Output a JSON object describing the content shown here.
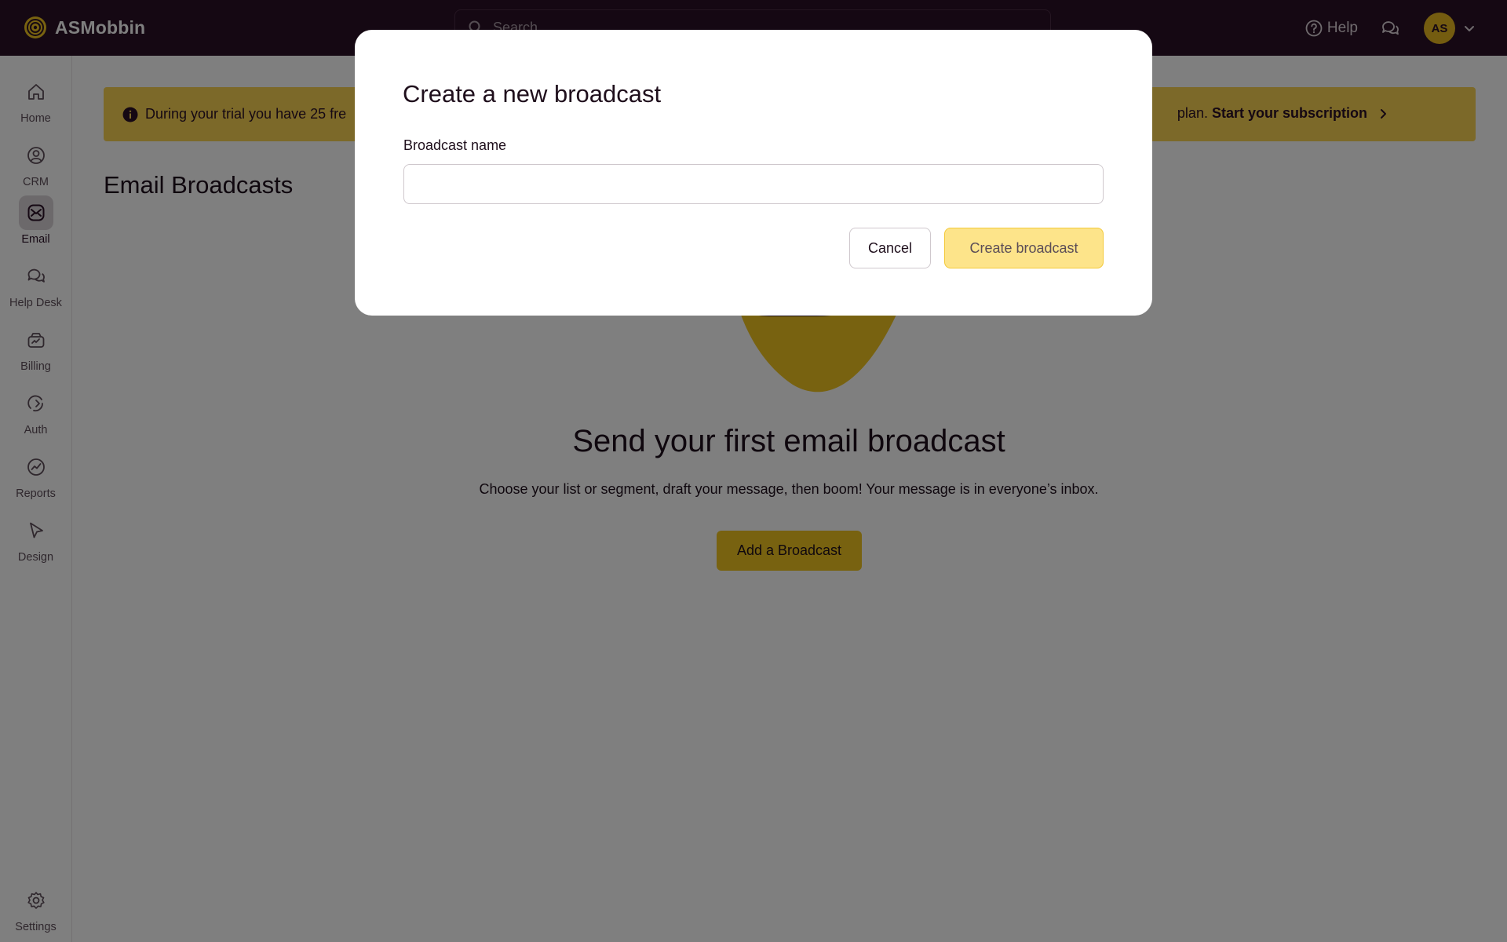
{
  "topbar": {
    "brand_name": "ASMobbin",
    "search_placeholder": "Search",
    "help_label": "Help",
    "avatar_initials": "AS"
  },
  "sidebar": {
    "items": [
      {
        "label": "Home",
        "icon": "home-icon"
      },
      {
        "label": "CRM",
        "icon": "contact-icon"
      },
      {
        "label": "Email",
        "icon": "email-icon",
        "active": true
      },
      {
        "label": "Help Desk",
        "icon": "chat-icon"
      },
      {
        "label": "Billing",
        "icon": "billing-icon"
      },
      {
        "label": "Auth",
        "icon": "auth-icon"
      },
      {
        "label": "Reports",
        "icon": "chart-icon"
      },
      {
        "label": "Design",
        "icon": "cursor-icon"
      },
      {
        "label": "Settings",
        "icon": "gear-icon"
      }
    ]
  },
  "banner": {
    "text": "During your trial you have 25 fre",
    "cta_prefix": "plan. ",
    "cta_link": "Start your subscription"
  },
  "main": {
    "title": "Email Broadcasts",
    "empty_title": "Send your first email broadcast",
    "empty_desc": "Choose your list or segment, draft your message, then boom! Your message is in everyone’s inbox.",
    "add_button": "Add a Broadcast"
  },
  "modal": {
    "title": "Create a new broadcast",
    "field_label": "Broadcast name",
    "field_value": "",
    "cancel_label": "Cancel",
    "create_label": "Create broadcast"
  },
  "colors": {
    "topbar": "#2a1026",
    "accent": "#f0c520",
    "banner": "#f8d252",
    "create_button": "#fde48a"
  }
}
